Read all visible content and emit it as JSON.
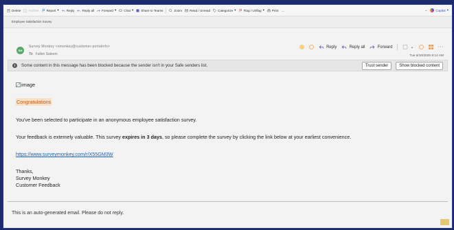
{
  "ribbon": {
    "items": [
      {
        "label": "Delete",
        "icon": "trash-icon",
        "disabled": false
      },
      {
        "label": "Archive",
        "icon": "archive-icon",
        "disabled": true
      },
      {
        "label": "Report",
        "icon": "report-icon",
        "disabled": false
      },
      {
        "label": "Reply",
        "icon": "reply-icon",
        "disabled": false
      },
      {
        "label": "Reply all",
        "icon": "reply-all-icon",
        "disabled": false
      },
      {
        "label": "Forward",
        "icon": "forward-icon",
        "disabled": false
      },
      {
        "label": "Chat",
        "icon": "chat-icon",
        "disabled": false
      },
      {
        "label": "Share to Teams",
        "icon": "teams-icon",
        "disabled": false
      },
      {
        "label": "Zoom",
        "icon": "zoom-icon",
        "disabled": false
      },
      {
        "label": "Read / Unread",
        "icon": "envelope-icon",
        "disabled": false
      },
      {
        "label": "Categorize",
        "icon": "tag-icon",
        "disabled": false
      },
      {
        "label": "Flag / Unflag",
        "icon": "flag-icon",
        "disabled": false
      },
      {
        "label": "Print",
        "icon": "print-icon",
        "disabled": false
      }
    ],
    "more": "…",
    "copilot_label": "Copilot"
  },
  "subject": "Employee Satisfaction Survey",
  "header": {
    "avatar_initials": "SM",
    "from": "Survey Monkey <smonkey@customer-portalinfo>",
    "to_label": "To:",
    "to_name": "Fallen Saleem",
    "reply_label": "Reply",
    "reply_all_label": "Reply all",
    "forward_label": "Forward",
    "timestamp": "Tue 6/10/2025 8:14 AM"
  },
  "blocked_bar": {
    "message": "Some content in this message has been blocked because the sender isn't in your Safe senders list.",
    "trust_label": "Trust sender",
    "show_label": "Show blocked content"
  },
  "body": {
    "image_alt": "image",
    "congrats": "Congratulations",
    "para1": "You've been selected to participate in an anonymous employee satisfaction survey.",
    "para2_before": "Your feedback is extemely valuable.  This survey ",
    "para2_bold": "expires in 3 days",
    "para2_after": ", so please complete the survey by clicking the link below at your earliest convenience.",
    "link": "https://www.surveymonkey.com/r/X55GM3W",
    "thanks": "Thanks,",
    "sig1": "Survey Monkey",
    "sig2": "Customer Feedback",
    "footer": "This is an auto-generated email.  Please do not reply."
  },
  "colors": {
    "accent": "#1a5fb4",
    "highlight_bg": "#f7e0c8",
    "highlight_text": "#c65a12",
    "frame": "#1c2a6e"
  }
}
